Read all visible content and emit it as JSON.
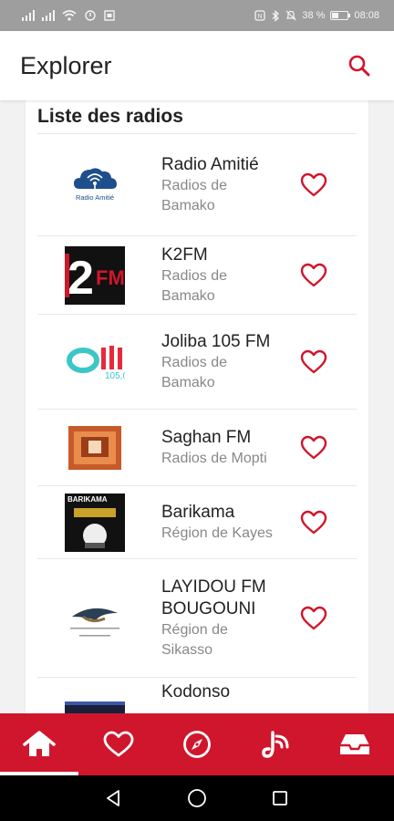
{
  "status_bar": {
    "left_icons": [
      "signal-icon",
      "signal-icon",
      "wifi-icon",
      "alert-icon",
      "photo-icon"
    ],
    "battery_text": "38 %",
    "battery_level": 0.38,
    "time": "08:08"
  },
  "app_bar": {
    "title": "Explorer",
    "search_icon": "search-icon"
  },
  "list": {
    "heading": "Liste des radios",
    "items": [
      {
        "name": "Radio Amitié",
        "region": "Radios de Bamako",
        "logo": "radio-amitie-logo",
        "favorite_icon": "heart-outline-icon"
      },
      {
        "name": "K2FM",
        "region": "Radios de Bamako",
        "logo": "k2fm-logo",
        "favorite_icon": "heart-outline-icon"
      },
      {
        "name": "Joliba 105 FM",
        "region": "Radios de Bamako",
        "logo": "joliba-logo",
        "favorite_icon": "heart-outline-icon"
      },
      {
        "name": "Saghan FM",
        "region": "Radios de Mopti",
        "logo": "saghan-logo",
        "favorite_icon": "heart-outline-icon"
      },
      {
        "name": "Barikama",
        "region": "Région de Kayes",
        "logo": "barikama-logo",
        "logo_text": "BARIKAMA",
        "favorite_icon": "heart-outline-icon"
      },
      {
        "name": "LAYIDOU FM BOUGOUNI",
        "region": "Région de Sikasso",
        "logo": "layidou-logo",
        "favorite_icon": "heart-outline-icon"
      },
      {
        "name": "Kodonso",
        "region": "",
        "logo": "kodonso-logo",
        "favorite_icon": "heart-outline-icon"
      }
    ]
  },
  "bottom_nav": {
    "items": [
      {
        "icon": "home-icon",
        "active": true
      },
      {
        "icon": "heart-icon",
        "active": false
      },
      {
        "icon": "compass-icon",
        "active": false
      },
      {
        "icon": "broadcast-icon",
        "active": false
      },
      {
        "icon": "inbox-icon",
        "active": false
      }
    ]
  },
  "system_nav": [
    "back-icon",
    "home-circle-icon",
    "recents-icon"
  ],
  "colors": {
    "accent": "#d0162c",
    "status_bar": "#9e9e9e",
    "background": "#f2f2f2"
  }
}
